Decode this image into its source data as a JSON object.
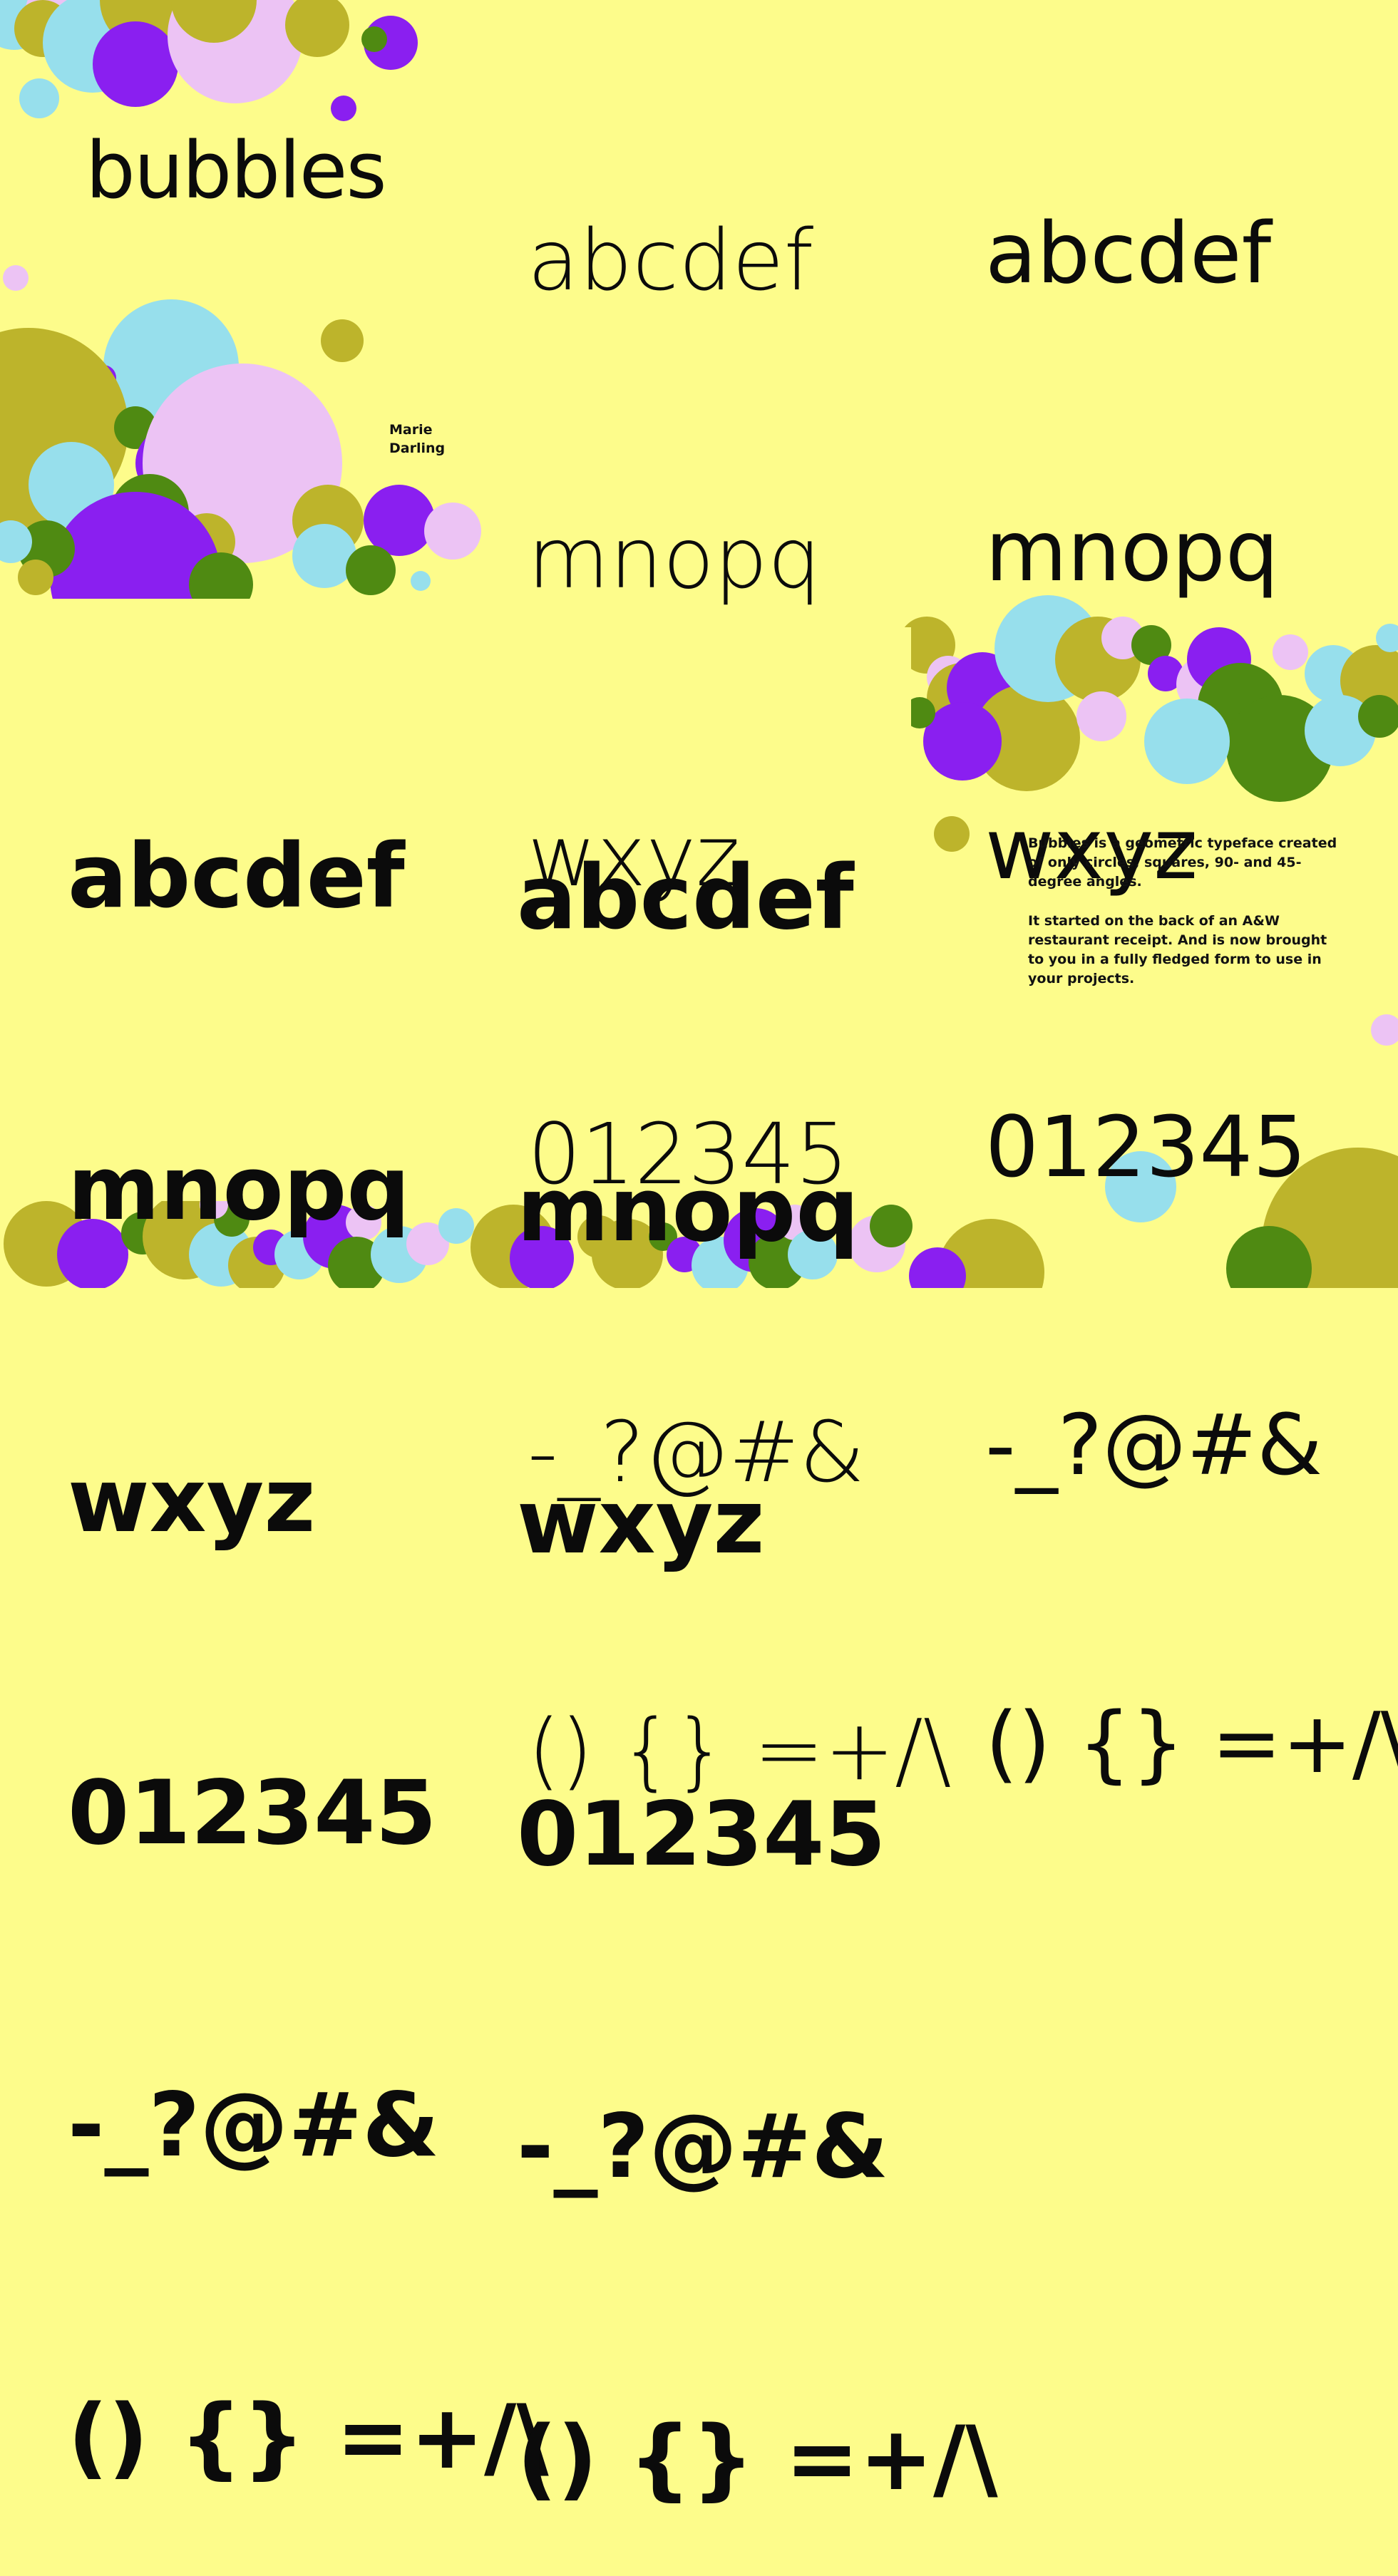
{
  "title": "bubbles",
  "author": {
    "first": "Marie",
    "last": "Darling"
  },
  "description": [
    "Bubbles is a geometric typeface created of only circles, squares, 90- and 45-degree angles.",
    "It started on the back of an A&W restaurant receipt. And is now brought to you in a fully fledged form to use in your projects."
  ],
  "specimen_lines": [
    "abcdef",
    "mnopq",
    "wxyz",
    "012345",
    "-_?@#&",
    "() {} =+/\\"
  ],
  "colors": {
    "background": "#fdfc8b",
    "olive": "#bdb42b",
    "purple": "#8a1ff0",
    "light_blue": "#97dfec",
    "pink": "#ecc3f4",
    "green": "#4f8a12",
    "ink": "#0b0b0b"
  }
}
